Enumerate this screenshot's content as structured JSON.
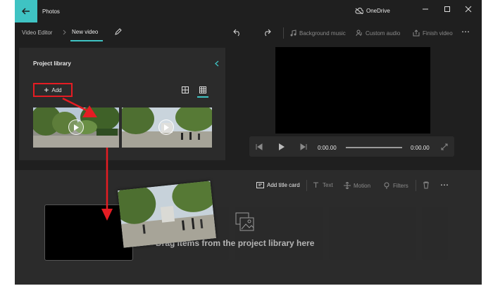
{
  "app": {
    "title": "Photos",
    "cloud": "OneDrive"
  },
  "breadcrumb": {
    "parent": "Video Editor",
    "current": "New video"
  },
  "toolbar": {
    "background_music": "Background music",
    "custom_audio": "Custom audio",
    "finish_video": "Finish video"
  },
  "library": {
    "title": "Project library",
    "add_label": "Add"
  },
  "player": {
    "time_current": "0:00.00",
    "time_total": "0:00.00",
    "progress": 0
  },
  "storyboard": {
    "add_title_card": "Add title card",
    "text": "Text",
    "motion": "Motion",
    "filters": "Filters",
    "drop_hint": "Drag items from the project library here"
  },
  "colors": {
    "accent": "#3fc3c3",
    "annotation": "#e51c23",
    "panel": "#2b2b2b",
    "background": "#1f1f1f"
  }
}
